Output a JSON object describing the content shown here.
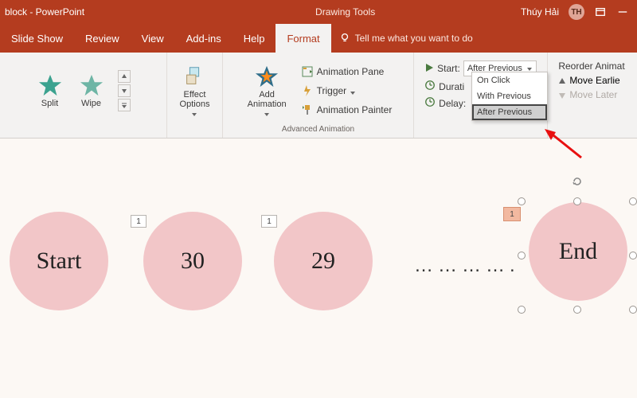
{
  "titlebar": {
    "doc_app": "block  -  PowerPoint",
    "context_tab": "Drawing Tools",
    "user_name": "Thúy Hải",
    "user_initials": "TH"
  },
  "tabs": {
    "slide_show": "Slide Show",
    "review": "Review",
    "view": "View",
    "addins": "Add-ins",
    "help": "Help",
    "format": "Format",
    "tellme": "Tell me what you want to do"
  },
  "ribbon": {
    "gallery": {
      "split": "Split",
      "wipe": "Wipe"
    },
    "effect_options": "Effect\nOptions",
    "add_animation": "Add\nAnimation",
    "animation_pane": "Animation Pane",
    "trigger": "Trigger",
    "animation_painter": "Animation Painter",
    "group_advanced": "Advanced Animation",
    "start_label": "Start:",
    "start_value": "After Previous",
    "duration_label": "Durati",
    "delay_label": "Delay:",
    "reorder_title": "Reorder Animat",
    "move_earlier": "Move Earlie",
    "move_later": "Move Later"
  },
  "dropdown": {
    "opt1": "On Click",
    "opt2": "With Previous",
    "opt3": "After Previous"
  },
  "slide": {
    "circle1": "Start",
    "circle2": "30",
    "circle3": "29",
    "dots": "………….",
    "circle_end": "End",
    "tag1": "1",
    "tag2": "1",
    "tag3": "1"
  }
}
